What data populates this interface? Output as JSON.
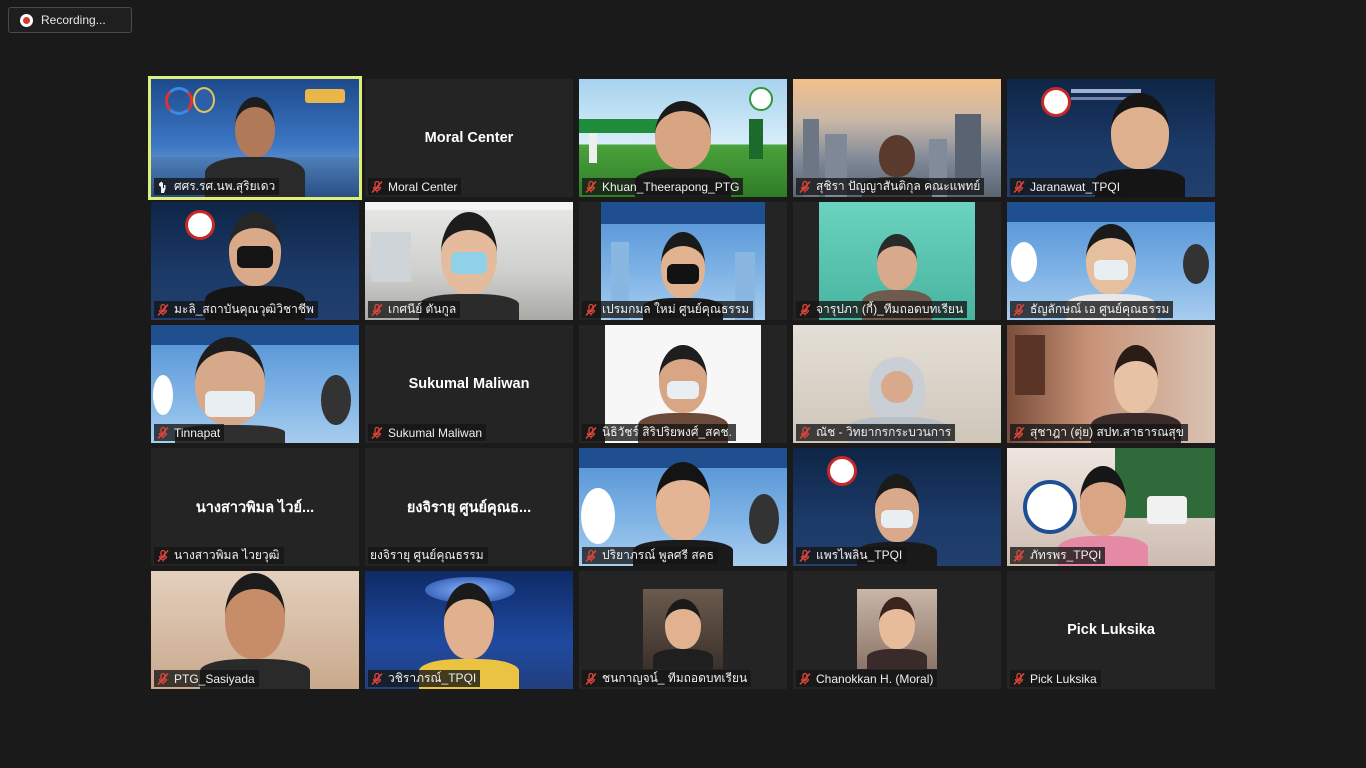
{
  "recording": {
    "label": "Recording..."
  },
  "participants": [
    {
      "name": "ศศร.รศ.นพ.สุริยเดว",
      "status": "hand"
    },
    {
      "name": "Moral Center",
      "display": "Moral Center",
      "status": "muted"
    },
    {
      "name": "Khuan_Theerapong_PTG",
      "status": "muted"
    },
    {
      "name": "สุชิรา ปัญญาสันติกุล คณะแพทย์",
      "status": "muted"
    },
    {
      "name": "Jaranawat_TPQI",
      "status": "muted"
    },
    {
      "name": "มะลิ_สถาบันคุณวุฒิวิชาชีพ",
      "status": "muted"
    },
    {
      "name": "เกศนีย์ ตันกูล",
      "status": "muted"
    },
    {
      "name": "เปรมกมล ใหม่ ศูนย์คุณธรรม",
      "status": "muted"
    },
    {
      "name": "จารุปภา (กี้)_ทีมถอดบทเรียน",
      "status": "muted"
    },
    {
      "name": "ธัญลักษณ์ เอ ศูนย์คุณธรรม",
      "status": "muted"
    },
    {
      "name": "Tinnapat",
      "status": "muted"
    },
    {
      "name": "Sukumal Maliwan",
      "display": "Sukumal Maliwan",
      "status": "muted"
    },
    {
      "name": "นิธิวัชร์ สิริปริยพงศ์_สคช.",
      "status": "muted"
    },
    {
      "name": "ณัช - วิทยากรกระบวนการ",
      "status": "muted"
    },
    {
      "name": "สุชาฎา (ตุ่ย) สปท.สาธารณสุข",
      "status": "muted"
    },
    {
      "name": "นางสาวพิมล ไวยวุฒิ",
      "display": "นางสาวพิมล ไวย์...",
      "status": "muted"
    },
    {
      "name": "ยงจิรายุ ศูนย์คุณธรรม",
      "display": "ยงจิรายุ ศูนย์คุณธ...",
      "status": "none"
    },
    {
      "name": "ปริยาภรณ์ พูลศรี สคธ",
      "status": "muted"
    },
    {
      "name": "แพรไพลิน_TPQI",
      "status": "muted"
    },
    {
      "name": "ภัทรพร_TPQI",
      "status": "muted"
    },
    {
      "name": "PTG_Sasiyada",
      "status": "muted"
    },
    {
      "name": "วชิราภรณ์_TPQI",
      "status": "muted"
    },
    {
      "name": "ชนกาญจน์_ ทีมถอดบทเรียน",
      "status": "muted"
    },
    {
      "name": "Chanokkan H. (Moral)",
      "status": "muted"
    },
    {
      "name": "Pick Luksika",
      "display": "Pick Luksika",
      "status": "muted"
    }
  ],
  "colors": {
    "active_speaker_border": "#dff07a",
    "muted_icon": "#e0463a",
    "background": "#1a1a1a"
  },
  "icons": {
    "muted": "mic-muted-icon",
    "hand": "raised-hand-icon",
    "recording": "record-icon"
  }
}
